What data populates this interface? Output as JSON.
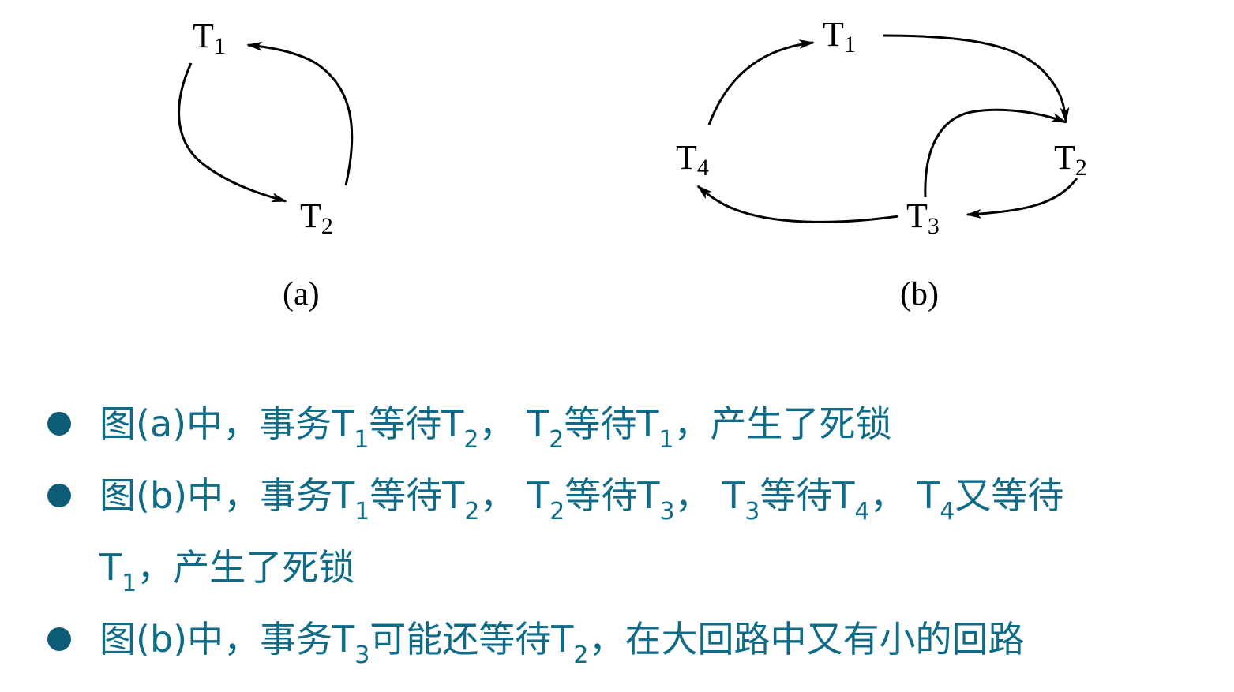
{
  "diagram": {
    "nodes": [
      {
        "id": "a-T1",
        "label": "T",
        "sub": "1"
      },
      {
        "id": "a-T2",
        "label": "T",
        "sub": "2"
      },
      {
        "id": "b-T1",
        "label": "T",
        "sub": "1"
      },
      {
        "id": "b-T2",
        "label": "T",
        "sub": "2"
      },
      {
        "id": "b-T3",
        "label": "T",
        "sub": "3"
      },
      {
        "id": "b-T4",
        "label": "T",
        "sub": "4"
      }
    ],
    "edges": [
      {
        "from": "a-T1",
        "to": "a-T2"
      },
      {
        "from": "a-T2",
        "to": "a-T1"
      },
      {
        "from": "b-T1",
        "to": "b-T2"
      },
      {
        "from": "b-T2",
        "to": "b-T3"
      },
      {
        "from": "b-T3",
        "to": "b-T4"
      },
      {
        "from": "b-T4",
        "to": "b-T1"
      },
      {
        "from": "b-T3",
        "to": "b-T2"
      }
    ],
    "captions": {
      "a": "(a)",
      "b": "(b)"
    }
  },
  "bullets": [
    {
      "segments": [
        {
          "t": "图(a)中，事务T"
        },
        {
          "s": "1"
        },
        {
          "t": "等待T"
        },
        {
          "s": "2"
        },
        {
          "t": "，  T"
        },
        {
          "s": "2"
        },
        {
          "t": "等待T"
        },
        {
          "s": "1"
        },
        {
          "t": "，产生了死锁"
        }
      ]
    },
    {
      "segments": [
        {
          "t": "图(b)中，事务T"
        },
        {
          "s": "1"
        },
        {
          "t": "等待T"
        },
        {
          "s": "2"
        },
        {
          "t": "，  T"
        },
        {
          "s": "2"
        },
        {
          "t": "等待T"
        },
        {
          "s": "3"
        },
        {
          "t": "，  T"
        },
        {
          "s": "3"
        },
        {
          "t": "等待T"
        },
        {
          "s": "4"
        },
        {
          "t": "，  T"
        },
        {
          "s": "4"
        },
        {
          "t": "又等待"
        },
        {
          "br": true
        },
        {
          "t": "T"
        },
        {
          "s": "1"
        },
        {
          "t": "，产生了死锁"
        }
      ]
    },
    {
      "segments": [
        {
          "t": "图(b)中，事务T"
        },
        {
          "s": "3"
        },
        {
          "t": "可能还等待T"
        },
        {
          "s": "2"
        },
        {
          "t": "，在大回路中又有小的回路"
        }
      ]
    }
  ],
  "colors": {
    "bullet_text": "#0f6b87",
    "bullet_dot": "#0e5d78"
  }
}
